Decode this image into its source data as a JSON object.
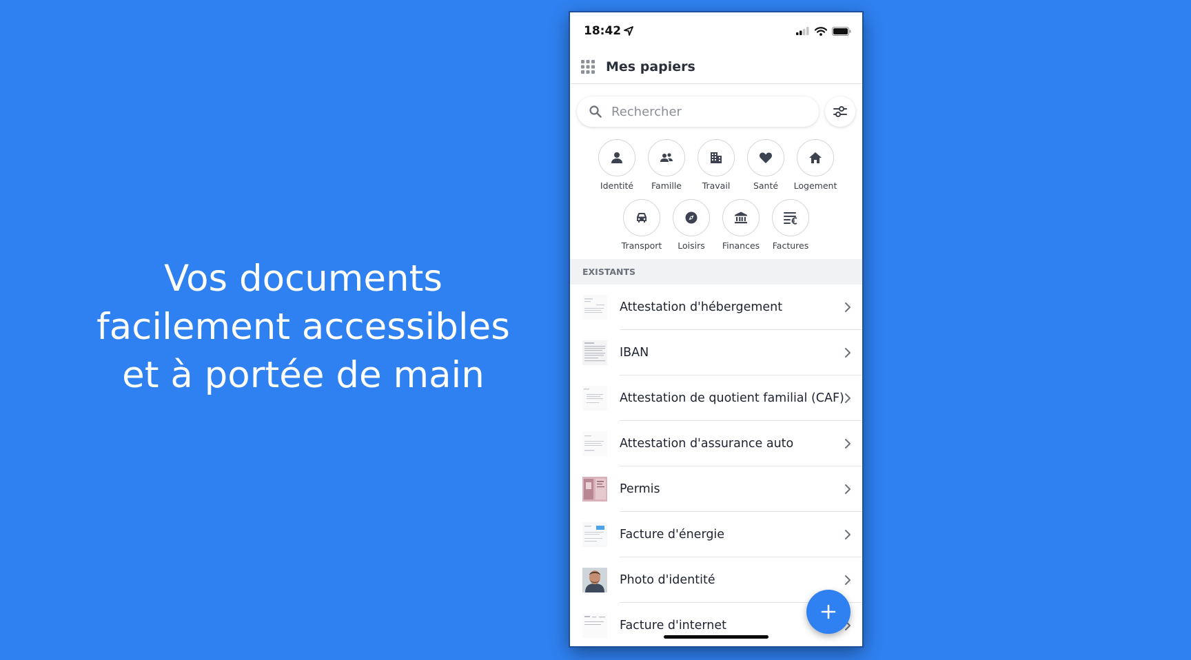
{
  "tagline": {
    "line1": "Vos documents",
    "line2": "facilement accessibles",
    "line3": "et à portée de main"
  },
  "status_bar": {
    "time": "18:42",
    "icons": [
      "location-arrow-icon",
      "cellular-signal-icon",
      "wifi-icon",
      "battery-icon"
    ]
  },
  "header": {
    "title": "Mes papiers",
    "menu_icon": "apps-grid-icon"
  },
  "search": {
    "placeholder": "Rechercher",
    "value": "",
    "filter_icon": "sliders-icon"
  },
  "categories": [
    {
      "label": "Identité",
      "icon": "person-icon"
    },
    {
      "label": "Famille",
      "icon": "people-icon"
    },
    {
      "label": "Travail",
      "icon": "building-icon"
    },
    {
      "label": "Santé",
      "icon": "heart-icon"
    },
    {
      "label": "Logement",
      "icon": "home-icon"
    },
    {
      "label": "Transport",
      "icon": "car-icon"
    },
    {
      "label": "Loisirs",
      "icon": "compass-icon"
    },
    {
      "label": "Finances",
      "icon": "bank-icon"
    },
    {
      "label": "Factures",
      "icon": "bill-icon"
    }
  ],
  "section": {
    "title": "EXISTANTS"
  },
  "documents": [
    {
      "label": "Attestation d'hébergement"
    },
    {
      "label": "IBAN"
    },
    {
      "label": "Attestation de quotient familial (CAF)"
    },
    {
      "label": "Attestation d'assurance auto"
    },
    {
      "label": "Permis"
    },
    {
      "label": "Facture d'énergie"
    },
    {
      "label": "Photo d'identité"
    },
    {
      "label": "Facture d'internet"
    }
  ],
  "fab": {
    "icon": "plus-icon"
  },
  "colors": {
    "background": "#2f80f0",
    "accent": "#2f80f0",
    "icon_dark": "#3c4250"
  }
}
